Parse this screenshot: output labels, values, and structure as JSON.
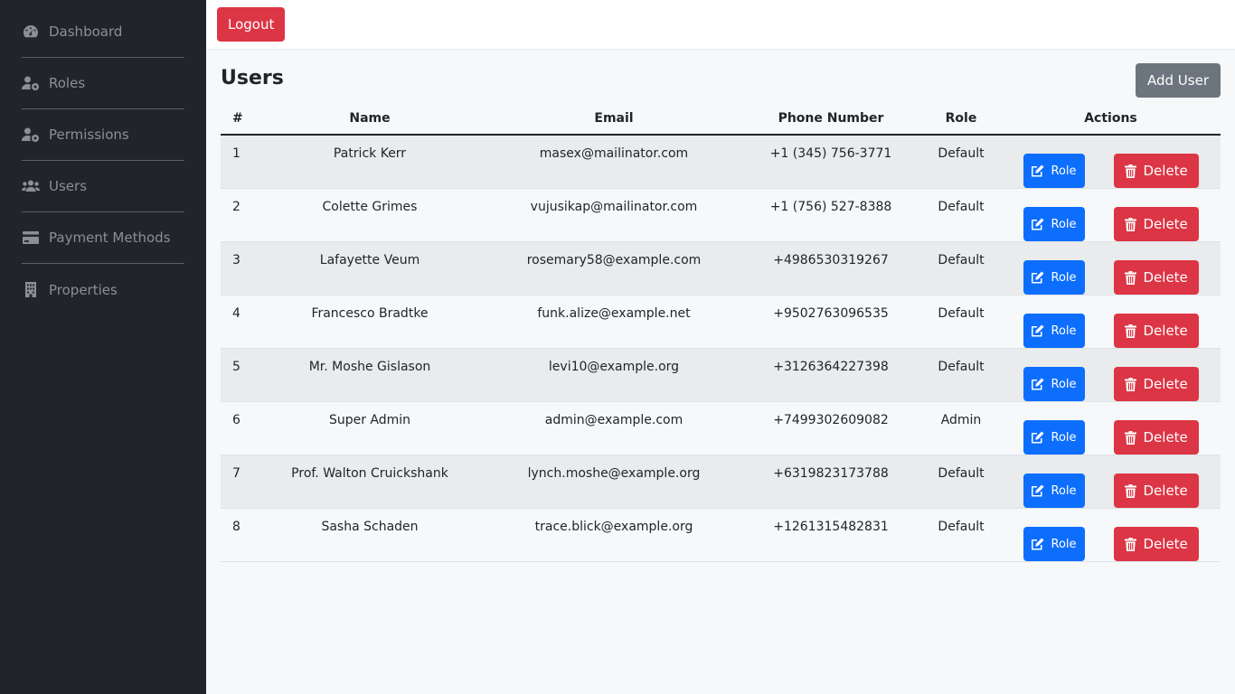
{
  "sidebar": {
    "items": [
      {
        "label": "Dashboard",
        "icon": "dashboard-icon"
      },
      {
        "label": "Roles",
        "icon": "user-gear-icon"
      },
      {
        "label": "Permissions",
        "icon": "user-gear-icon"
      },
      {
        "label": "Users",
        "icon": "users-icon"
      },
      {
        "label": "Payment Methods",
        "icon": "credit-card-icon"
      },
      {
        "label": "Properties",
        "icon": "building-icon"
      }
    ]
  },
  "topbar": {
    "logout_label": "Logout"
  },
  "page": {
    "title": "Users",
    "add_button_label": "Add User"
  },
  "table": {
    "headers": [
      "#",
      "Name",
      "Email",
      "Phone Number",
      "Role",
      "Actions"
    ],
    "rows": [
      {
        "num": "1",
        "name": "Patrick Kerr",
        "email": "masex@mailinator.com",
        "phone": "+1 (345) 756-3771",
        "role": "Default"
      },
      {
        "num": "2",
        "name": "Colette Grimes",
        "email": "vujusikap@mailinator.com",
        "phone": "+1 (756) 527-8388",
        "role": "Default"
      },
      {
        "num": "3",
        "name": "Lafayette Veum",
        "email": "rosemary58@example.com",
        "phone": "+4986530319267",
        "role": "Default"
      },
      {
        "num": "4",
        "name": "Francesco Bradtke",
        "email": "funk.alize@example.net",
        "phone": "+9502763096535",
        "role": "Default"
      },
      {
        "num": "5",
        "name": "Mr. Moshe Gislason",
        "email": "levi10@example.org",
        "phone": "+3126364227398",
        "role": "Default"
      },
      {
        "num": "6",
        "name": "Super Admin",
        "email": "admin@example.com",
        "phone": "+7499302609082",
        "role": "Admin"
      },
      {
        "num": "7",
        "name": "Prof. Walton Cruickshank",
        "email": "lynch.moshe@example.org",
        "phone": "+6319823173788",
        "role": "Default"
      },
      {
        "num": "8",
        "name": "Sasha Schaden",
        "email": "trace.blick@example.org",
        "phone": "+1261315482831",
        "role": "Default"
      }
    ],
    "role_button_label": "Role",
    "delete_button_label": "Delete"
  },
  "colors": {
    "sidebar_bg": "#212529",
    "primary": "#0d6efd",
    "danger": "#dc3545",
    "secondary": "#6c757d"
  }
}
